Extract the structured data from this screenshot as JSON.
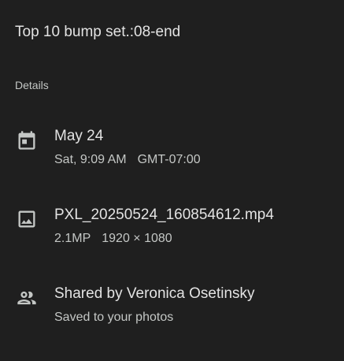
{
  "header": {
    "title": "Top 10 bump set.:08-end"
  },
  "details": {
    "section_label": "Details",
    "date": {
      "icon": "calendar-icon",
      "primary": "May 24",
      "day_time": "Sat, 9:09 AM",
      "timezone": "GMT-07:00"
    },
    "file": {
      "icon": "image-icon",
      "primary": "PXL_20250524_160854612.mp4",
      "megapixels": "2.1MP",
      "resolution": "1920 × 1080"
    },
    "shared": {
      "icon": "people-icon",
      "primary": "Shared by Veronica Osetinsky",
      "secondary": "Saved to your photos"
    }
  },
  "colors": {
    "background": "#1f1f1f",
    "primary_text": "#e3e3e3",
    "secondary_text": "#c4c7c5"
  }
}
